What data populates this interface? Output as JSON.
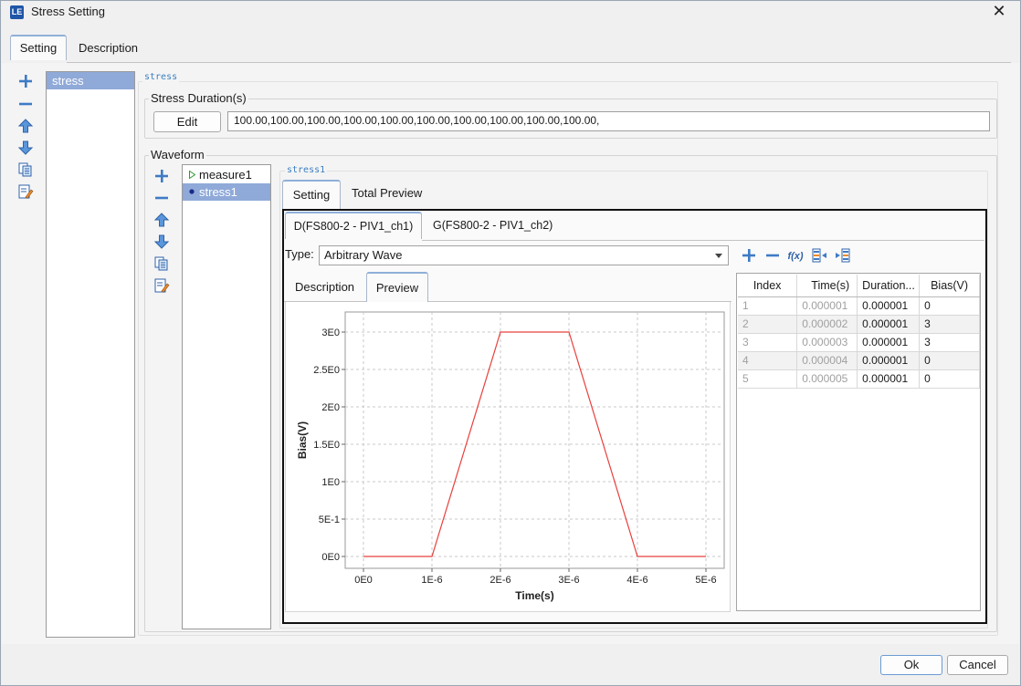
{
  "window": {
    "title": "Stress Setting",
    "app_icon_text": "LE",
    "close_glyph": "✕"
  },
  "top_tabs": [
    {
      "label": "Setting",
      "active": true
    },
    {
      "label": "Description",
      "active": false
    }
  ],
  "left_toolbar_icons": [
    "add-icon",
    "remove-icon",
    "move-up-icon",
    "move-down-icon",
    "copy-icon",
    "edit-icon"
  ],
  "stress_list": [
    "stress"
  ],
  "stress_section": {
    "title": "stress",
    "duration_group_title": "Stress Duration(s)",
    "edit_label": "Edit",
    "durations_value": "100.00,100.00,100.00,100.00,100.00,100.00,100.00,100.00,100.00,100.00,",
    "waveform_group_title": "Waveform"
  },
  "waveform_list": [
    {
      "label": "measure1",
      "marker": "triangle",
      "selected": false
    },
    {
      "label": "stress1",
      "marker": "dot",
      "selected": true
    }
  ],
  "waveform_detail": {
    "title": "stress1",
    "tabs": [
      {
        "label": "Setting",
        "active": true
      },
      {
        "label": "Total Preview",
        "active": false
      }
    ],
    "channel_tabs": [
      {
        "label": "D(FS800-2 - PIV1_ch1)",
        "active": true
      },
      {
        "label": "G(FS800-2 - PIV1_ch2)",
        "active": false
      }
    ],
    "type_label": "Type:",
    "type_value": "Arbitrary Wave",
    "sub_tabs": [
      {
        "label": "Description",
        "active": false
      },
      {
        "label": "Preview",
        "active": true
      }
    ],
    "table_toolbar_icons": [
      "add-row-icon",
      "remove-row-icon",
      "function-icon",
      "insert-before-icon",
      "insert-after-icon"
    ],
    "function_glyph": "f(x)",
    "table": {
      "columns": [
        "Index",
        "Time(s)",
        "Duration...",
        "Bias(V)"
      ],
      "rows": [
        [
          "1",
          "0.000001",
          "0.000001",
          "0"
        ],
        [
          "2",
          "0.000002",
          "0.000001",
          "3"
        ],
        [
          "3",
          "0.000003",
          "0.000001",
          "3"
        ],
        [
          "4",
          "0.000004",
          "0.000001",
          "0"
        ],
        [
          "5",
          "0.000005",
          "0.000001",
          "0"
        ]
      ]
    }
  },
  "chart_data": {
    "type": "line",
    "title": "",
    "xlabel": "Time(s)",
    "ylabel": "Bias(V)",
    "xlim": [
      0,
      5e-06
    ],
    "ylim": [
      0,
      3
    ],
    "x_tick_labels": [
      "0E0",
      "1E-6",
      "2E-6",
      "3E-6",
      "4E-6",
      "5E-6"
    ],
    "y_tick_labels": [
      "0E0",
      "5E-1",
      "1E0",
      "1.5E0",
      "2E0",
      "2.5E0",
      "3E0"
    ],
    "grid": true,
    "series": [
      {
        "color": "#e8403c",
        "x": [
          0,
          1e-06,
          2e-06,
          3e-06,
          4e-06,
          5e-06
        ],
        "y": [
          0,
          0,
          3,
          3,
          0,
          0
        ]
      }
    ]
  },
  "footer": {
    "ok_label": "Ok",
    "cancel_label": "Cancel"
  }
}
